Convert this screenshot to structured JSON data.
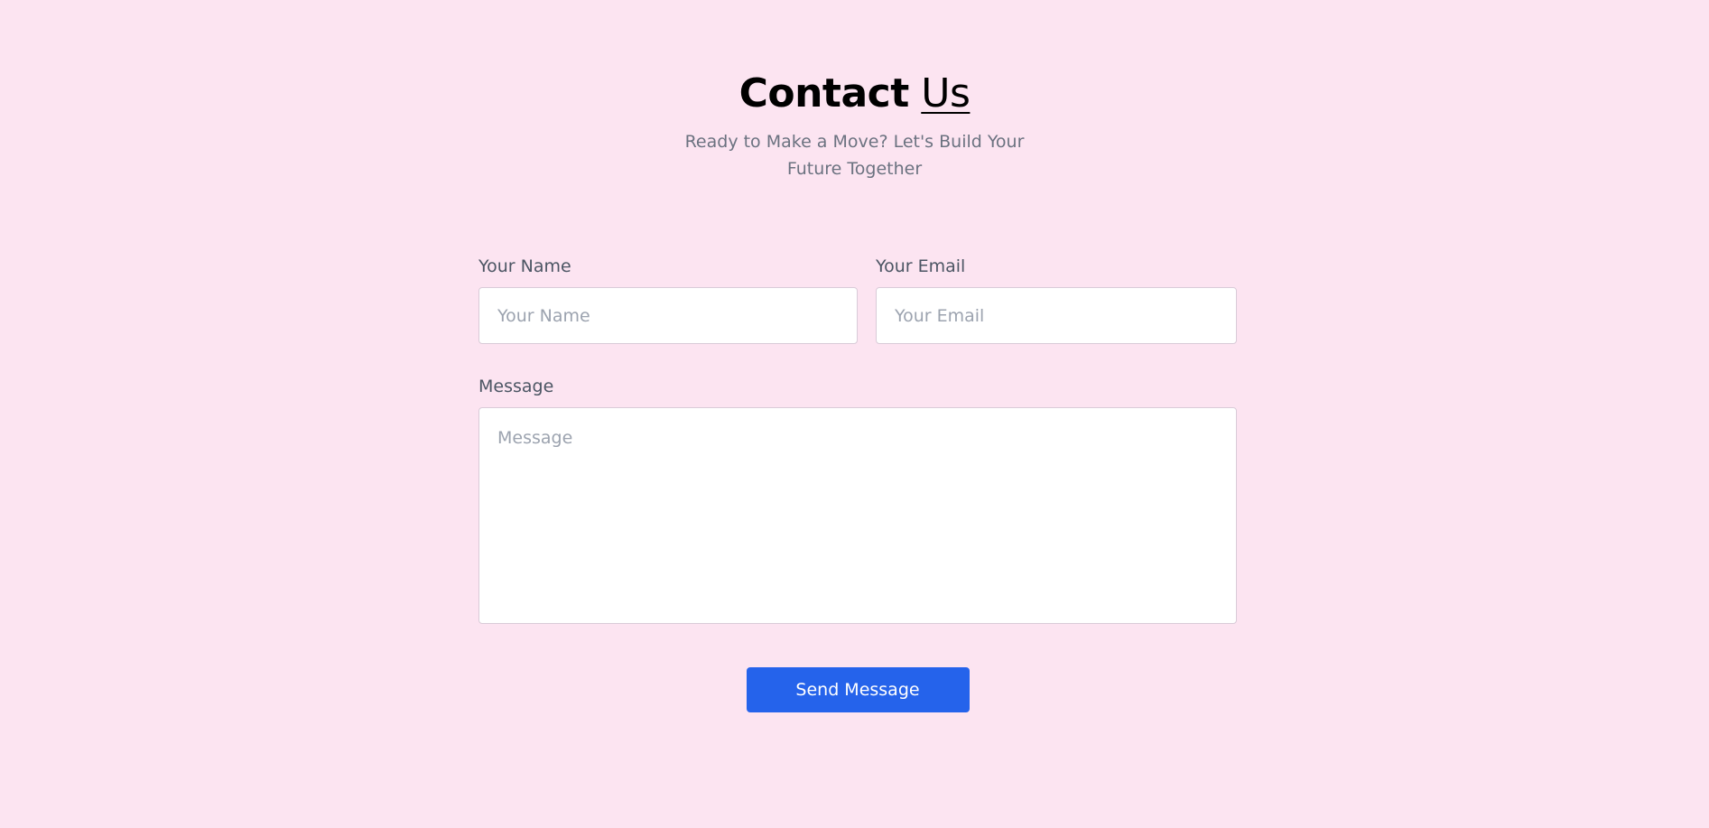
{
  "header": {
    "title_strong": "Contact",
    "title_light": "Us",
    "subtitle": "Ready to Make a Move? Let's Build Your Future Together"
  },
  "form": {
    "name_label": "Your Name",
    "name_placeholder": "Your Name",
    "email_label": "Your Email",
    "email_placeholder": "Your Email",
    "message_label": "Message",
    "message_placeholder": "Message",
    "submit_label": "Send Message"
  },
  "colors": {
    "background": "#fce4f1",
    "button": "#2563eb",
    "heading": "#000000",
    "subtitle": "#6b7280"
  }
}
